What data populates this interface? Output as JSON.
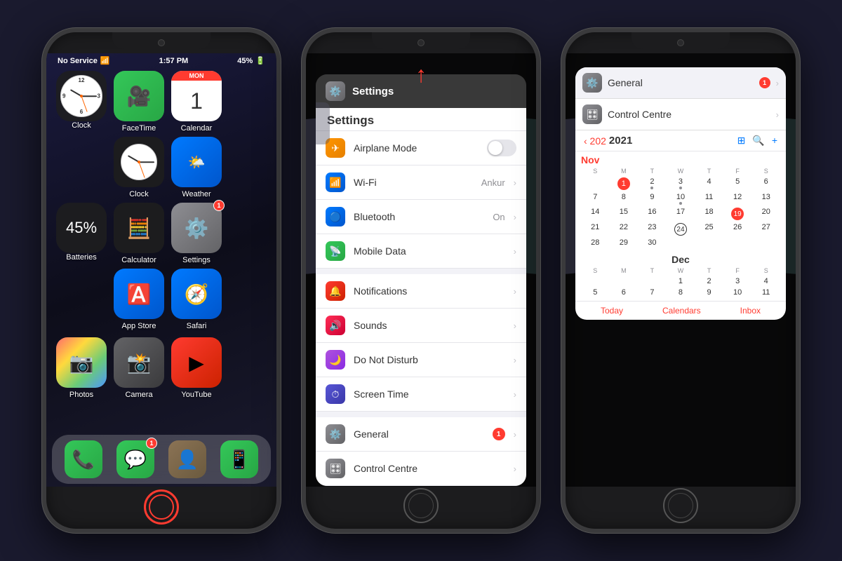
{
  "phones": {
    "phone1": {
      "status": {
        "carrier": "No Service",
        "time": "1:57 PM",
        "battery": "45%"
      },
      "clock_widget": {
        "label": "Clock"
      },
      "apps_row1": [
        {
          "name": "Clock",
          "label": "Clock",
          "type": "clock2"
        },
        {
          "name": "Weather",
          "label": "Weather",
          "type": "weather"
        }
      ],
      "apps_row0": [
        {
          "name": "FaceTime",
          "label": "FaceTime",
          "type": "facetime"
        },
        {
          "name": "Calendar",
          "label": "Calendar",
          "type": "calendar",
          "date_day": "MON",
          "date_num": "1"
        }
      ],
      "apps_row2": [
        {
          "name": "App Store",
          "label": "App Store",
          "type": "appstore"
        },
        {
          "name": "Safari",
          "label": "Safari",
          "type": "safari"
        },
        {
          "name": "Settings",
          "label": "Settings",
          "type": "settings",
          "badge": "1"
        }
      ],
      "battery_pct": "45%",
      "batteries_label": "Batteries",
      "apps_row3": [
        {
          "name": "Photos",
          "label": "Photos",
          "type": "photos"
        },
        {
          "name": "Camera",
          "label": "Camera",
          "type": "camera"
        },
        {
          "name": "YouTube",
          "label": "YouTube",
          "type": "youtube"
        }
      ],
      "dock": [
        {
          "name": "Phone",
          "label": "Phone",
          "type": "phone"
        },
        {
          "name": "Messages",
          "label": "Messages",
          "type": "messages",
          "badge": "1"
        },
        {
          "name": "Contacts",
          "label": "Contacts",
          "type": "contacts"
        },
        {
          "name": "WhatsApp",
          "label": "WhatsApp",
          "type": "whatsapp"
        }
      ]
    },
    "phone2": {
      "settings_title": "Settings",
      "settings_header": "Settings",
      "arrow_indicator": "↑",
      "items_group1": [
        {
          "key": "airplane",
          "label": "Airplane Mode",
          "value": "",
          "type": "toggle",
          "color": "orange"
        },
        {
          "key": "wifi",
          "label": "Wi-Fi",
          "value": "Ankur",
          "type": "arrow",
          "color": "blue"
        },
        {
          "key": "bluetooth",
          "label": "Bluetooth",
          "value": "On",
          "type": "arrow",
          "color": "blue"
        },
        {
          "key": "mobile_data",
          "label": "Mobile Data",
          "value": "",
          "type": "arrow",
          "color": "green"
        }
      ],
      "items_group2": [
        {
          "key": "notifications",
          "label": "Notifications",
          "value": "",
          "type": "arrow",
          "color": "red"
        },
        {
          "key": "sounds",
          "label": "Sounds",
          "value": "",
          "type": "arrow",
          "color": "red_pink"
        },
        {
          "key": "do_not_disturb",
          "label": "Do Not Disturb",
          "value": "",
          "type": "arrow",
          "color": "purple"
        },
        {
          "key": "screen_time",
          "label": "Screen Time",
          "value": "",
          "type": "arrow",
          "color": "purple2"
        }
      ],
      "items_group3": [
        {
          "key": "general",
          "label": "General",
          "value": "1",
          "type": "arrow_badge",
          "color": "gray"
        },
        {
          "key": "control_centre",
          "label": "Control Centre",
          "value": "",
          "type": "arrow",
          "color": "gray"
        }
      ]
    },
    "phone3": {
      "apps": [
        {
          "name": "General",
          "label": "General",
          "badge": "1",
          "color": "gray"
        },
        {
          "name": "Control Centre",
          "label": "Control Centre",
          "badge": "",
          "color": "gray"
        }
      ],
      "calendar": {
        "year": "2021",
        "nav_back": "< 202",
        "months": [
          {
            "name": "Nov",
            "color": "red",
            "dow": [
              "S",
              "M",
              "T",
              "W",
              "T",
              "F",
              "S"
            ],
            "weeks": [
              [
                null,
                1,
                2,
                3,
                4,
                5,
                6
              ],
              [
                7,
                8,
                9,
                10,
                11,
                12,
                13
              ],
              [
                14,
                15,
                16,
                17,
                18,
                19,
                20
              ],
              [
                21,
                22,
                23,
                24,
                25,
                26,
                27
              ],
              [
                28,
                29,
                30,
                null,
                null,
                null,
                null
              ]
            ],
            "today": 1,
            "dots": [
              2,
              3,
              10,
              19
            ]
          },
          {
            "name": "Dec",
            "color": "black",
            "dow": [
              "S",
              "M",
              "T",
              "W",
              "T",
              "F",
              "S"
            ],
            "weeks": [
              [
                null,
                null,
                null,
                1,
                2,
                3,
                4
              ],
              [
                5,
                6,
                7,
                8,
                9,
                10,
                11
              ]
            ],
            "today": null,
            "dots": []
          }
        ],
        "bottom_buttons": [
          "Today",
          "Calendars",
          "Inbox"
        ]
      }
    }
  }
}
